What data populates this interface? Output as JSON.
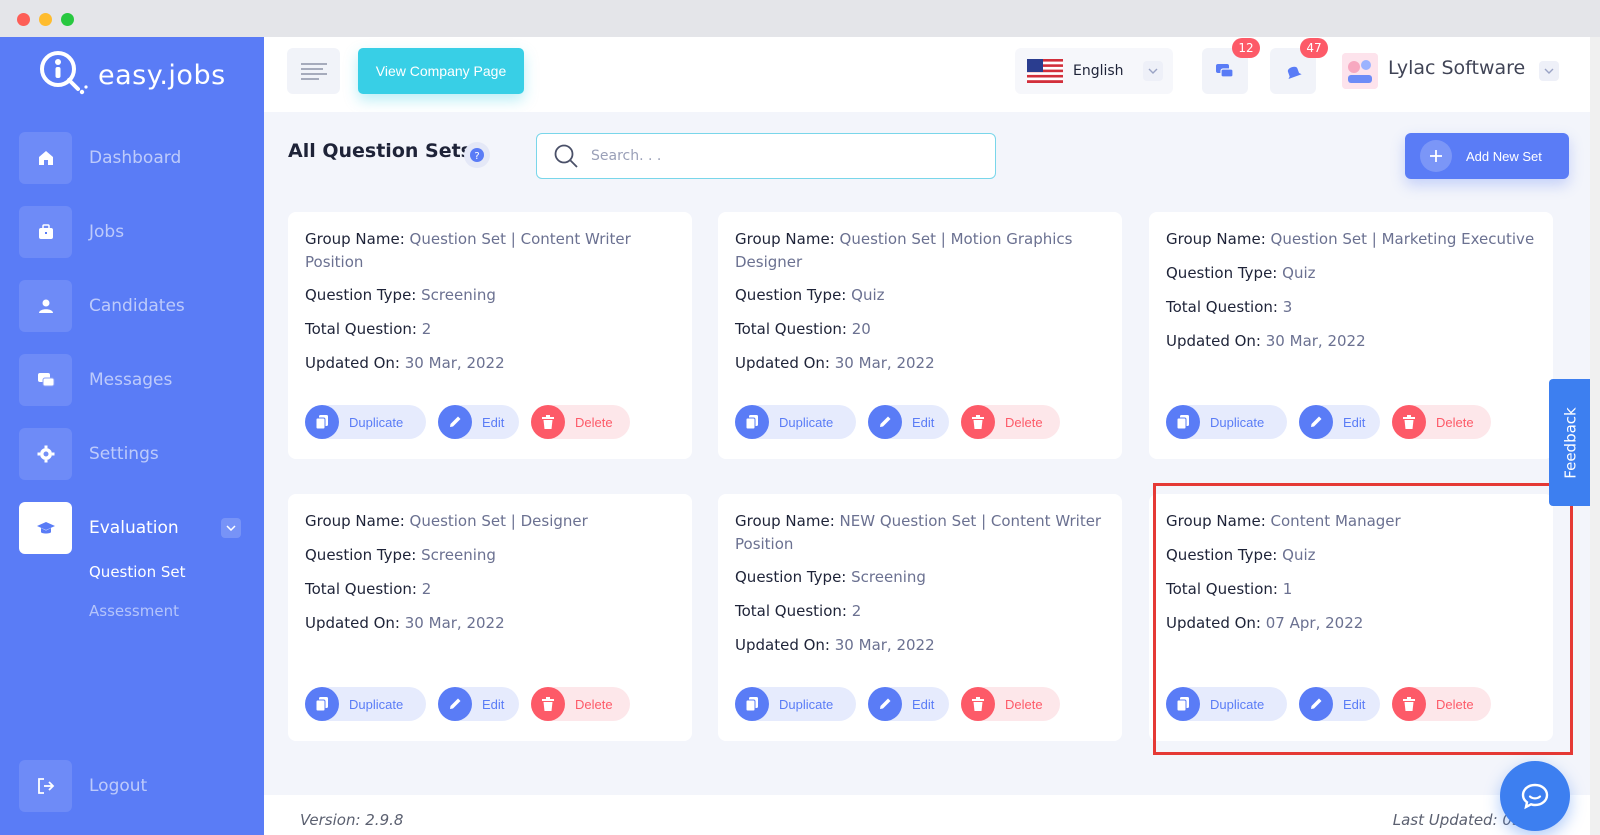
{
  "brand": {
    "name": "easy.jobs"
  },
  "sidebar": {
    "items": [
      {
        "label": "Dashboard",
        "icon": "home-icon"
      },
      {
        "label": "Jobs",
        "icon": "briefcase-icon"
      },
      {
        "label": "Candidates",
        "icon": "user-icon"
      },
      {
        "label": "Messages",
        "icon": "chat-icon"
      },
      {
        "label": "Settings",
        "icon": "gear-icon"
      },
      {
        "label": "Evaluation",
        "icon": "graduation-cap-icon",
        "active": true
      }
    ],
    "sub_items": [
      {
        "label": "Question Set",
        "active": true
      },
      {
        "label": "Assessment",
        "active": false
      }
    ],
    "logout_label": "Logout"
  },
  "header": {
    "view_company_label": "View Company Page",
    "language": "English",
    "messages_count": "12",
    "notifications_count": "47",
    "company_name": "Lylac Software"
  },
  "main": {
    "title": "All Question Sets",
    "search_placeholder": "Search. . .",
    "add_label": "Add New Set"
  },
  "labels": {
    "group_name": "Group Name:",
    "question_type": "Question Type:",
    "total_question": "Total Question:",
    "updated_on": "Updated On:",
    "duplicate": "Duplicate",
    "edit": "Edit",
    "delete": "Delete"
  },
  "cards": [
    {
      "group": "Question Set | Content Writer Position",
      "type": "Screening",
      "total": "2",
      "updated": "30 Mar, 2022"
    },
    {
      "group": "Question Set | Motion Graphics Designer",
      "type": "Quiz",
      "total": "20",
      "updated": "30 Mar, 2022"
    },
    {
      "group": "Question Set | Marketing Executive",
      "type": "Quiz",
      "total": "3",
      "updated": "30 Mar, 2022"
    },
    {
      "group": "Question Set | Designer",
      "type": "Screening",
      "total": "2",
      "updated": "30 Mar, 2022"
    },
    {
      "group": "NEW Question Set | Content Writer Position",
      "type": "Screening",
      "total": "2",
      "updated": "30 Mar, 2022"
    },
    {
      "group": "Content Manager",
      "type": "Quiz",
      "total": "1",
      "updated": "07 Apr, 2022"
    }
  ],
  "feedback_label": "Feedback",
  "footer": {
    "version": "Version: 2.9.8",
    "last_updated": "Last Updated: 09-04"
  },
  "colors": {
    "sidebar": "#5a7cf6",
    "accent": "#5a7cf6",
    "cyan": "#38cfe6",
    "danger": "#fd5a68",
    "highlight": "#e53935"
  }
}
